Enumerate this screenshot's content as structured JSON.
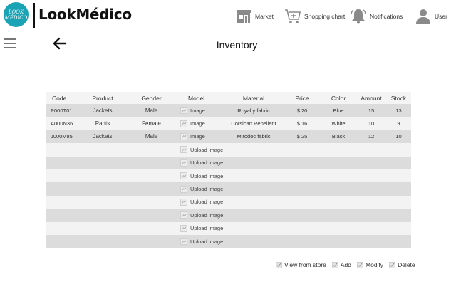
{
  "brand": {
    "logo_line1": "LOOK",
    "logo_line2": "MÉDICO",
    "name": "LookMédico",
    "accent_color": "#1aa3b5"
  },
  "nav": {
    "market": {
      "label": "Market",
      "icon": "store-icon"
    },
    "cart": {
      "label": "Shopping chart",
      "icon": "shopping-cart-icon"
    },
    "notifications": {
      "label": "Notifications",
      "icon": "bell-icon"
    },
    "user": {
      "label": "User",
      "icon": "user-icon"
    }
  },
  "page": {
    "title": "Inventory"
  },
  "table": {
    "columns": [
      "Code",
      "Product",
      "Gender",
      "Model",
      "Material",
      "Price",
      "Color",
      "Amount",
      "Stock"
    ],
    "rows": [
      {
        "code": "P000T01",
        "product": "Jackets",
        "gender": "Male",
        "model": "Image",
        "material": "Royalty fabric",
        "price": "$ 20",
        "color": "Blue",
        "amount": "15",
        "stock": "13"
      },
      {
        "code": "A000N36",
        "product": "Pants",
        "gender": "Female",
        "model": "Image",
        "material": "Corsican Repellent",
        "price": "$ 16",
        "color": "White",
        "amount": "10",
        "stock": "9"
      },
      {
        "code": "J000M85",
        "product": "Jackets",
        "gender": "Male",
        "model": "Image",
        "material": "Mirodoc fabric",
        "price": "$ 25",
        "color": "Black",
        "amount": "12",
        "stock": "10"
      },
      {
        "code": "",
        "product": "",
        "gender": "",
        "model": "Upload image",
        "material": "",
        "price": "",
        "color": "",
        "amount": "",
        "stock": ""
      },
      {
        "code": "",
        "product": "",
        "gender": "",
        "model": "Upload image",
        "material": "",
        "price": "",
        "color": "",
        "amount": "",
        "stock": ""
      },
      {
        "code": "",
        "product": "",
        "gender": "",
        "model": "Upload image",
        "material": "",
        "price": "",
        "color": "",
        "amount": "",
        "stock": ""
      },
      {
        "code": "",
        "product": "",
        "gender": "",
        "model": "Upload image",
        "material": "",
        "price": "",
        "color": "",
        "amount": "",
        "stock": ""
      },
      {
        "code": "",
        "product": "",
        "gender": "",
        "model": "Upload image",
        "material": "",
        "price": "",
        "color": "",
        "amount": "",
        "stock": ""
      },
      {
        "code": "",
        "product": "",
        "gender": "",
        "model": "Upload image",
        "material": "",
        "price": "",
        "color": "",
        "amount": "",
        "stock": ""
      },
      {
        "code": "",
        "product": "",
        "gender": "",
        "model": "Upload image",
        "material": "",
        "price": "",
        "color": "",
        "amount": "",
        "stock": ""
      },
      {
        "code": "",
        "product": "",
        "gender": "",
        "model": "Upload image",
        "material": "",
        "price": "",
        "color": "",
        "amount": "",
        "stock": ""
      }
    ]
  },
  "actions": {
    "view_from_store": "View from store",
    "add": "Add",
    "modify": "Modify",
    "delete": "Delete"
  }
}
